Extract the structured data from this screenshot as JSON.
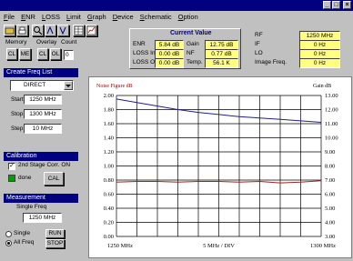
{
  "window": {
    "title": ""
  },
  "menu": [
    "File",
    "ENR",
    "LOSS",
    "Limit",
    "Graph",
    "Device",
    "Schematic",
    "Option"
  ],
  "toolbar": {
    "memory_label": "Memory",
    "overlay_label": "Overlay",
    "count_label": "Count",
    "cl": "CL",
    "me": "ME",
    "ol": "OL",
    "count_value": "0"
  },
  "current_value": {
    "title": "Current Value",
    "rows": [
      {
        "l1": "ENR",
        "v1": "5.84 dB",
        "l2": "Gain",
        "v2": "12.75 dB"
      },
      {
        "l1": "LOSS In",
        "v1": "0.00 dB",
        "l2": "NF",
        "v2": "0.77 dB"
      },
      {
        "l1": "LOSS Out",
        "v1": "0.00 dB",
        "l2": "Temp.",
        "v2": "56.1 K"
      }
    ]
  },
  "freq_readout": [
    {
      "label": "RF",
      "value": "1250 MHz"
    },
    {
      "label": "IF",
      "value": "0 Hz"
    },
    {
      "label": "LO",
      "value": "0 Hz"
    },
    {
      "label": "Image Freq.",
      "value": "0 Hz"
    }
  ],
  "create_freq": {
    "title": "Create Freq List",
    "mode": "DIRECT",
    "start_label": "Start",
    "start_value": "1250 MHz",
    "stop_label": "Stop",
    "stop_value": "1300 MHz",
    "step_label": "Step",
    "step_value": "10 MHz"
  },
  "calibration": {
    "title": "Calibration",
    "second_stage": "2nd Stage Corr. ON",
    "done": "done",
    "cal_button": "CAL"
  },
  "measurement": {
    "title": "Measurement",
    "single_freq_label": "Single Freq",
    "single_freq_value": "1250 MHz",
    "single": "Single",
    "all_freq": "All Freq",
    "run": "RUN",
    "stop": "STOP"
  },
  "chart_data": {
    "type": "line",
    "ylabel_left": "Noise Figure dB",
    "ylabel_right": "Gain dB",
    "x_left_label": "1250 MHz",
    "x_center_label": "5 MHz / DIV",
    "x_right_label": "1300 MHz",
    "y_left_ticks": [
      "2.00",
      "1.80",
      "1.60",
      "1.40",
      "1.20",
      "1.00",
      "0.80",
      "0.60",
      "0.40",
      "0.20",
      "0.00"
    ],
    "y_right_ticks": [
      "13.00",
      "12.00",
      "11.00",
      "10.00",
      "9.00",
      "8.00",
      "7.00",
      "6.00",
      "5.00",
      "4.00",
      "3.00"
    ],
    "ylim_left": [
      0,
      2
    ],
    "ylim_right": [
      3,
      13
    ],
    "x": [
      1250,
      1255,
      1260,
      1265,
      1270,
      1275,
      1280,
      1285,
      1290,
      1295,
      1300
    ],
    "series": [
      {
        "axis": "right",
        "color": "#20208c",
        "values": [
          12.75,
          12.5,
          12.25,
          12.0,
          11.8,
          11.65,
          11.5,
          11.4,
          11.3,
          11.2,
          11.1
        ]
      },
      {
        "axis": "left",
        "color": "#a02020",
        "values": [
          0.77,
          0.78,
          0.78,
          0.77,
          0.78,
          0.78,
          0.77,
          0.78,
          0.76,
          0.77,
          0.79
        ]
      }
    ]
  }
}
